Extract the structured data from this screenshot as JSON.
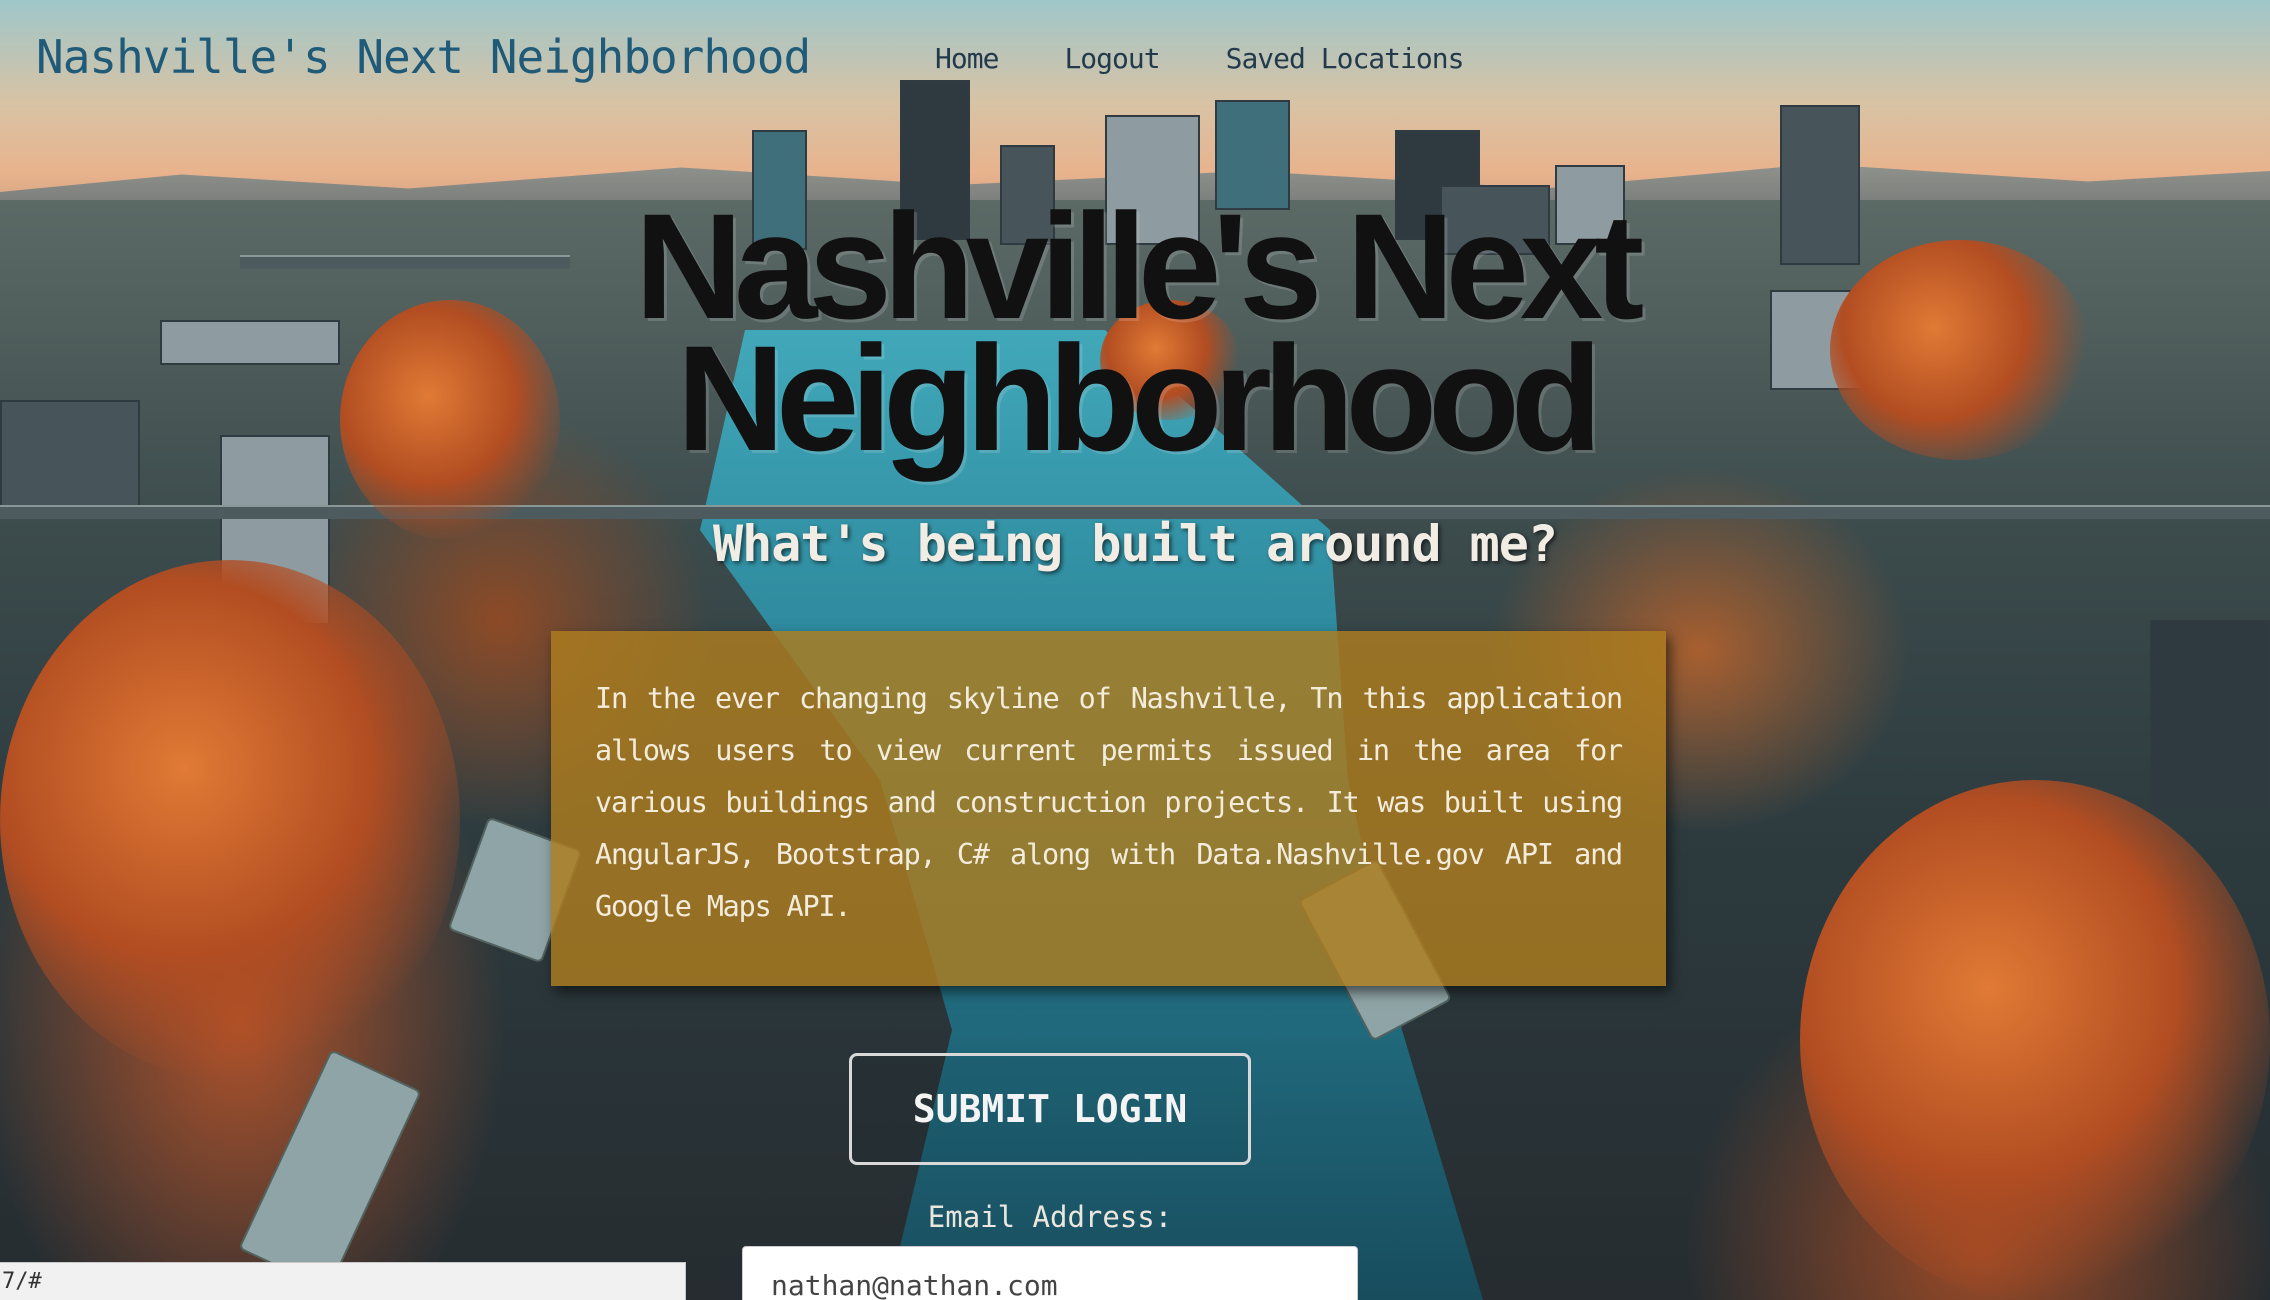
{
  "navbar": {
    "brand": "Nashville's Next Neighborhood",
    "links": [
      {
        "label": "Home"
      },
      {
        "label": "Logout"
      },
      {
        "label": "Saved Locations"
      }
    ]
  },
  "hero": {
    "title_line1": "Nashville's Next",
    "title_line2": "Neighborhood",
    "subtitle": "What's being built around me?",
    "description": "In the ever changing skyline of Nashville, Tn this application allows users to view current permits issued in the area for various buildings and construction projects. It was built using AngularJS, Bootstrap, C# along with Data.Nashville.gov API and Google Maps API."
  },
  "login": {
    "submit_label": "SUBMIT LOGIN",
    "email_label": "Email Address:",
    "email_value": "nathan@nathan.com"
  },
  "status_bar": {
    "url_text": "7/#"
  },
  "colors": {
    "brand_text": "#1f5a78",
    "about_box_bg": "#ad7c1f",
    "hero_title": "#111111"
  },
  "background": {
    "description_icon": "nashville-skyline-photo"
  }
}
